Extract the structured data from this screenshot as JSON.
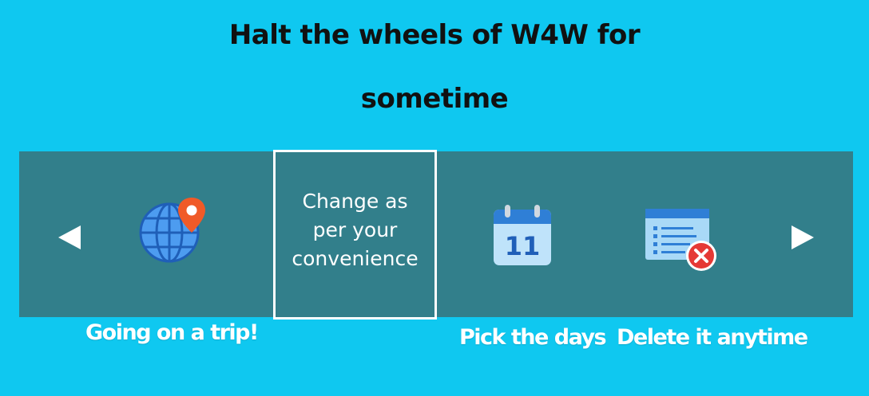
{
  "header": {
    "title_line1": "Halt the wheels of W4W for",
    "title_line2": "sometime"
  },
  "carousel": {
    "prev_icon": "triangle-left",
    "next_icon": "triangle-right",
    "highlighted_text": "Change as\nper your\nconvenience",
    "items": [
      {
        "icon": "globe-location-icon",
        "label": "Going on a trip!"
      },
      {
        "icon": "calendar-icon",
        "label": "Pick the days",
        "calendar_day": "11"
      },
      {
        "icon": "delete-list-icon",
        "label": "Delete it anytime"
      }
    ]
  },
  "colors": {
    "background": "#0fc8f0",
    "band": "#327f8b",
    "text_dark": "#111111",
    "text_light": "#ffffff",
    "accent_red": "#e53935",
    "accent_blue": "#2f7fd6"
  }
}
